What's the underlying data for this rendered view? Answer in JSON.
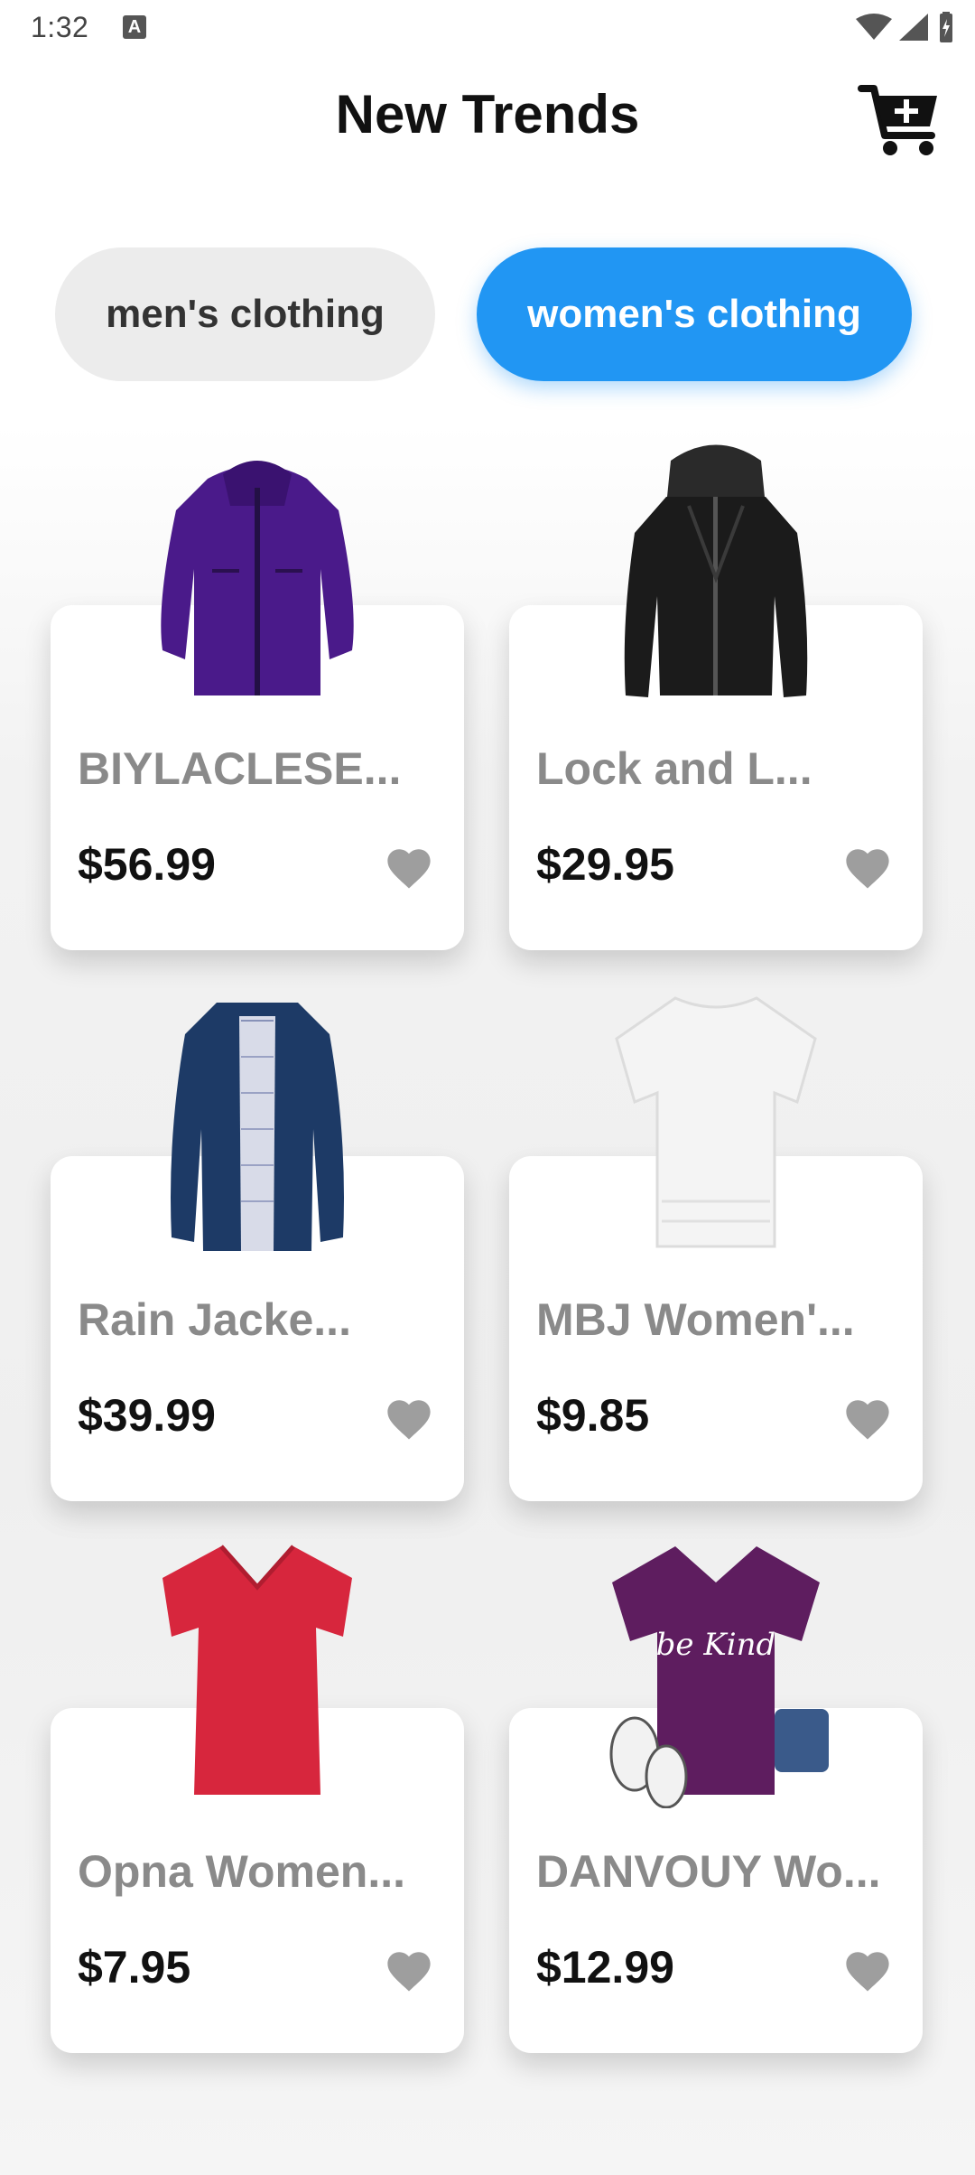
{
  "status_bar": {
    "time": "1:32",
    "indicator": "A"
  },
  "header": {
    "title": "New Trends",
    "cart_icon": "cart-add-icon"
  },
  "tabs": [
    {
      "label": "men's clothing",
      "selected": false
    },
    {
      "label": "women's clothing",
      "selected": true
    }
  ],
  "colors": {
    "accent": "#2196f3",
    "tab_inactive": "#ececec",
    "muted_text": "#8a8a8a",
    "heart": "#9e9e9e"
  },
  "products": [
    {
      "name": "BIYLACLESE...",
      "price": "$56.99",
      "image": "purple-jacket"
    },
    {
      "name": "Lock and L...",
      "price": "$29.95",
      "image": "black-leather-jacket"
    },
    {
      "name": "Rain Jacke...",
      "price": "$39.99",
      "image": "navy-rain-jacket"
    },
    {
      "name": "MBJ Women'...",
      "price": "$9.85",
      "image": "white-tshirt"
    },
    {
      "name": "Opna Women...",
      "price": "$7.95",
      "image": "red-tshirt"
    },
    {
      "name": "DANVOUY Wo...",
      "price": "$12.99",
      "image": "purple-be-kind-tshirt",
      "shirt_text": "be Kind"
    }
  ]
}
